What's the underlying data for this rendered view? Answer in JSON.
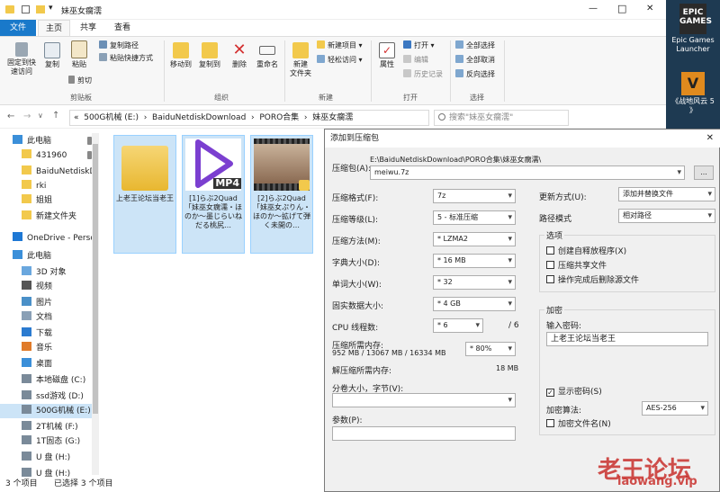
{
  "explorer": {
    "title": "妹巫女瘸濡",
    "window_controls": [
      "—",
      "□",
      "✕"
    ],
    "tabs": [
      "文件",
      "主页",
      "共享",
      "查看"
    ],
    "ribbon": {
      "clipboard": {
        "pin": "固定到快\n速访问",
        "copy": "复制",
        "paste": "粘贴",
        "copy_path": "复制路径",
        "paste_shortcut": "粘贴快捷方式",
        "cut": "剪切",
        "group": "剪贴板"
      },
      "organize": {
        "move_to": "移动到",
        "copy_to": "复制到",
        "delete": "删除",
        "rename": "重命名",
        "group": "组织"
      },
      "new": {
        "new_folder": "新建\n文件夹",
        "new_item": "新建项目 ▾",
        "easy_access": "轻松访问 ▾",
        "group": "新建"
      },
      "open": {
        "properties": "属性",
        "open": "打开 ▾",
        "edit": "编辑",
        "history": "历史记录",
        "group": "打开"
      },
      "select": {
        "select_all": "全部选择",
        "select_none": "全部取消",
        "invert": "反向选择",
        "group": "选择"
      }
    },
    "address": {
      "nav_glyphs": [
        "←",
        "→",
        "∨",
        "↑"
      ],
      "path": "«  500G机械 (E:)  ›  BaiduNetdiskDownload  ›  PORO合集  ›  妹巫女瘸濡",
      "search_placeholder": "搜索\"妹巫女瘸濡\""
    },
    "nav_items": [
      {
        "label": "此电脑",
        "icon": "computer-icon",
        "pinned": true
      },
      {
        "label": "431960",
        "icon": "folder-icon",
        "pinned": true
      },
      {
        "label": "BaiduNetdiskD",
        "icon": "folder-icon"
      },
      {
        "label": "rki",
        "icon": "folder-icon"
      },
      {
        "label": "姐姐",
        "icon": "folder-icon"
      },
      {
        "label": "新建文件夹",
        "icon": "folder-icon"
      },
      {
        "label": "OneDrive - Perso",
        "icon": "cloud-icon"
      },
      {
        "label": "此电脑",
        "icon": "computer-icon"
      },
      {
        "label": "3D 对象",
        "icon": "cube-icon"
      },
      {
        "label": "视频",
        "icon": "video-icon"
      },
      {
        "label": "图片",
        "icon": "picture-icon"
      },
      {
        "label": "文档",
        "icon": "document-icon"
      },
      {
        "label": "下载",
        "icon": "download-icon"
      },
      {
        "label": "音乐",
        "icon": "music-icon"
      },
      {
        "label": "桌面",
        "icon": "desktop-icon"
      },
      {
        "label": "本地磁盘 (C:)",
        "icon": "drive-icon"
      },
      {
        "label": "ssd游戏 (D:)",
        "icon": "drive-icon"
      },
      {
        "label": "500G机械 (E:)",
        "icon": "drive-icon",
        "selected": true
      },
      {
        "label": "2T机械 (F:)",
        "icon": "drive-icon"
      },
      {
        "label": "1T固态 (G:)",
        "icon": "drive-icon"
      },
      {
        "label": "U 盘 (H:)",
        "icon": "drive-icon"
      },
      {
        "label": "U 盘 (H:)",
        "icon": "drive-icon"
      }
    ],
    "files": [
      {
        "name": "上老王论坛当老王",
        "type": "folder"
      },
      {
        "name": "[1]らぶ2Quad「妹巫女瘸濡・ほのか～墨じらいねだる桃尻…",
        "type": "mp4",
        "badge": "MP4"
      },
      {
        "name": "[2]らぶ2Quad「妹巫女ぷりん・ほのか～拡げて弾く未開の…",
        "type": "video"
      }
    ],
    "status": {
      "count": "3 个项目",
      "selected": "已选择 3 个项目"
    }
  },
  "desktop": {
    "icons": [
      {
        "label": "Epic Games\nLauncher",
        "logo": "EPIC\nGAMES"
      },
      {
        "label": "《战地风云 5\n》",
        "logo": "V"
      }
    ]
  },
  "dialog": {
    "title": "添加到压缩包",
    "close": "✕",
    "archive_label": "压缩包(A):",
    "archive_path": "E:\\BaiduNetdiskDownload\\PORO合集\\妹巫女瘸濡\\",
    "archive_name": "meiwu.7z",
    "browse": "...",
    "left_rows": [
      {
        "label": "压缩格式(F):",
        "value": "7z"
      },
      {
        "label": "压缩等级(L):",
        "value": "5 - 标准压缩"
      },
      {
        "label": "压缩方法(M):",
        "value": "* LZMA2"
      },
      {
        "label": "字典大小(D):",
        "value": "* 16 MB"
      },
      {
        "label": "单词大小(W):",
        "value": "* 32"
      },
      {
        "label": "固实数据大小:",
        "value": "* 4 GB"
      }
    ],
    "cpu_label": "CPU 线程数:",
    "cpu_value": "* 6",
    "cpu_total": "/ 6",
    "mem_label": "压缩所需内存:",
    "mem_values": "952 MB / 13067 MB / 16334 MB",
    "mem_percent": "* 80%",
    "decomp_label": "解压缩所需内存:",
    "decomp_value": "18 MB",
    "split_label": "分卷大小，字节(V):",
    "split_value": "",
    "params_label": "参数(P):",
    "params_value": "",
    "update_label": "更新方式(U):",
    "update_value": "添加并替换文件",
    "pathmode_label": "路径模式",
    "pathmode_value": "相对路径",
    "options_title": "选项",
    "options": [
      {
        "label": "创建自释放程序(X)",
        "checked": false
      },
      {
        "label": "压缩共享文件",
        "checked": false
      },
      {
        "label": "操作完成后删除源文件",
        "checked": false
      }
    ],
    "encryption_title": "加密",
    "password_label": "输入密码:",
    "password_value": "上老王论坛当老王",
    "show_password": "显示密码(S)",
    "show_password_checked": true,
    "method_label": "加密算法:",
    "method_value": "AES-256",
    "encrypt_names": "加密文件名(N)",
    "encrypt_names_checked": false
  },
  "watermark": {
    "line1": "老王论坛",
    "line2": "laowang.vip"
  }
}
